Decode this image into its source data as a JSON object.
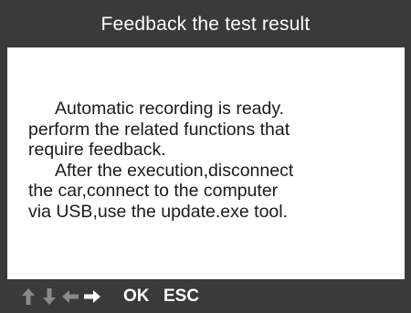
{
  "title": "Feedback the test result",
  "message": {
    "lines": [
      "Automatic recording is ready.",
      "perform the related functions that",
      "require feedback.",
      "After the execution,disconnect",
      "the car,connect to the computer",
      "via USB,use the update.exe tool."
    ]
  },
  "footer": {
    "keys": [
      {
        "icon": "arrow-up-icon",
        "enabled": false
      },
      {
        "icon": "arrow-down-icon",
        "enabled": false
      },
      {
        "icon": "arrow-left-icon",
        "enabled": false
      },
      {
        "icon": "arrow-right-icon",
        "enabled": true
      }
    ],
    "ok_label": "OK",
    "esc_label": "ESC"
  },
  "colors": {
    "frame": "#3a3a3a",
    "screen_bg": "#ffffff",
    "text": "#1a1a1a",
    "disabled_icon": "#8a8a8a",
    "enabled_icon": "#ffffff"
  }
}
